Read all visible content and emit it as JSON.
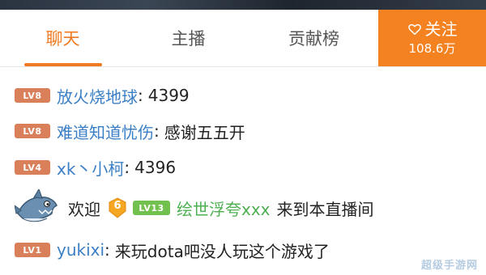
{
  "tabs": {
    "chat": "聊天",
    "anchor": "主播",
    "ranking": "贡献榜"
  },
  "follow": {
    "label": "关注",
    "count": "108.6万"
  },
  "messages": [
    {
      "level": "LV8",
      "user": "放火烧地球",
      "colon": ":",
      "text": "4399"
    },
    {
      "level": "LV8",
      "user": "难道知道忧伤",
      "colon": ":",
      "text": "感谢五五开"
    },
    {
      "level": "LV4",
      "user": "xk丶小柯",
      "colon": ":",
      "text": "4396"
    },
    {
      "welcome": "欢迎",
      "badge": "6",
      "level": "LV13",
      "user": "绘世浮夸xxx",
      "text": "来到本直播间"
    },
    {
      "level": "LV1",
      "user": "yukixi",
      "colon": ":",
      "text": "来玩dota吧没人玩这个游戏了"
    }
  ],
  "watermark": "超级手游网",
  "colors": {
    "accent": "#f58220",
    "username": "#3a7fc6",
    "level_badge": "#d9805a",
    "level_badge_high": "#72c04d"
  }
}
